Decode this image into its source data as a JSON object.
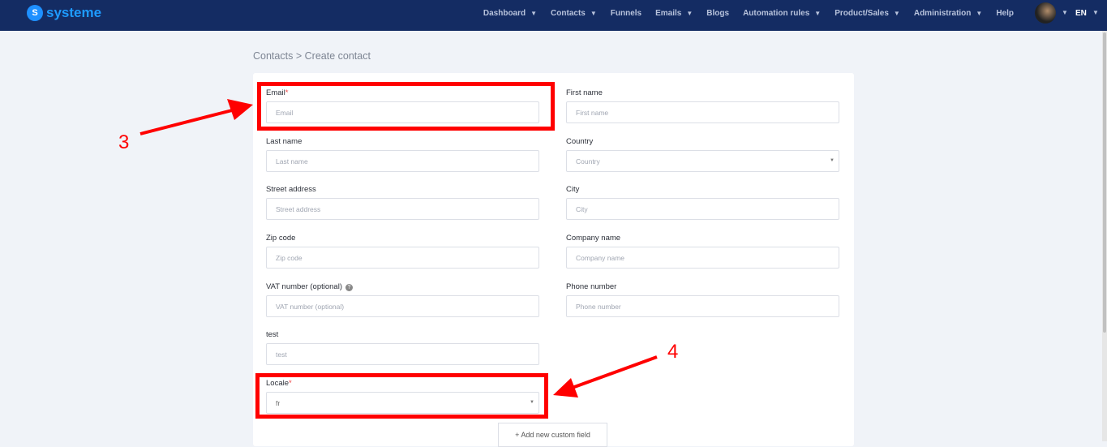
{
  "nav": {
    "brand": "systeme",
    "items": [
      {
        "label": "Dashboard",
        "dropdown": true
      },
      {
        "label": "Contacts",
        "dropdown": true
      },
      {
        "label": "Funnels",
        "dropdown": false
      },
      {
        "label": "Emails",
        "dropdown": true
      },
      {
        "label": "Blogs",
        "dropdown": false
      },
      {
        "label": "Automation rules",
        "dropdown": true
      },
      {
        "label": "Product/Sales",
        "dropdown": true
      },
      {
        "label": "Administration",
        "dropdown": true
      },
      {
        "label": "Help",
        "dropdown": false
      }
    ],
    "language": "EN"
  },
  "breadcrumb": {
    "parent": "Contacts",
    "separator": ">",
    "current": "Create contact"
  },
  "form": {
    "email": {
      "label": "Email",
      "required": "*",
      "placeholder": "Email"
    },
    "first_name": {
      "label": "First name",
      "placeholder": "First name"
    },
    "last_name": {
      "label": "Last name",
      "placeholder": "Last name"
    },
    "country": {
      "label": "Country",
      "placeholder": "Country"
    },
    "street": {
      "label": "Street address",
      "placeholder": "Street address"
    },
    "city": {
      "label": "City",
      "placeholder": "City"
    },
    "zip": {
      "label": "Zip code",
      "placeholder": "Zip code"
    },
    "company": {
      "label": "Company name",
      "placeholder": "Company name"
    },
    "vat": {
      "label": "VAT number (optional)",
      "placeholder": "VAT number (optional)",
      "help": "?"
    },
    "phone": {
      "label": "Phone number",
      "placeholder": "Phone number"
    },
    "test": {
      "label": "test",
      "placeholder": "test"
    },
    "locale": {
      "label": "Locale",
      "required": "*",
      "value": "fr"
    },
    "add_custom_field": "+   Add new custom field"
  },
  "annotations": {
    "step3": "3",
    "step4": "4",
    "color": "#ff0000"
  }
}
